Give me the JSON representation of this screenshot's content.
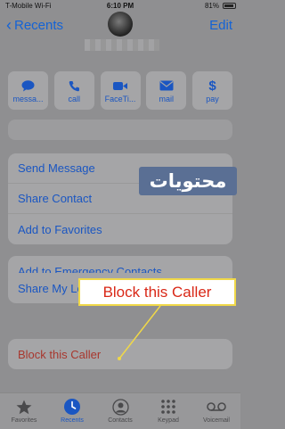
{
  "status_bar": {
    "carrier": "T-Mobile Wi-Fi",
    "time": "6:10 PM",
    "battery": "81%"
  },
  "nav": {
    "back_label": "Recents",
    "edit_label": "Edit"
  },
  "quick_actions": [
    {
      "label": "messa...",
      "icon": "message-icon"
    },
    {
      "label": "call",
      "icon": "phone-icon"
    },
    {
      "label": "FaceTi...",
      "icon": "video-icon"
    },
    {
      "label": "mail",
      "icon": "mail-icon"
    },
    {
      "label": "pay",
      "icon": "dollar-icon"
    }
  ],
  "menu_group_1": [
    "Send Message",
    "Share Contact",
    "Add to Favorites"
  ],
  "menu_group_2": [
    "Add to Emergency Contacts"
  ],
  "menu_group_3": [
    "Share My Location"
  ],
  "menu_group_4": [
    "Block this Caller"
  ],
  "watermark": "محتويات",
  "callout": "Block this Caller",
  "tabs": [
    {
      "label": "Favorites",
      "icon": "star-icon",
      "active": false
    },
    {
      "label": "Recents",
      "icon": "clock-icon",
      "active": true
    },
    {
      "label": "Contacts",
      "icon": "person-icon",
      "active": false
    },
    {
      "label": "Keypad",
      "icon": "keypad-icon",
      "active": false
    },
    {
      "label": "Voicemail",
      "icon": "voicemail-icon",
      "active": false
    }
  ],
  "colors": {
    "accent": "#1a56c2",
    "danger": "#a8372e",
    "callout_text": "#d92817",
    "callout_border": "#f0d848"
  }
}
